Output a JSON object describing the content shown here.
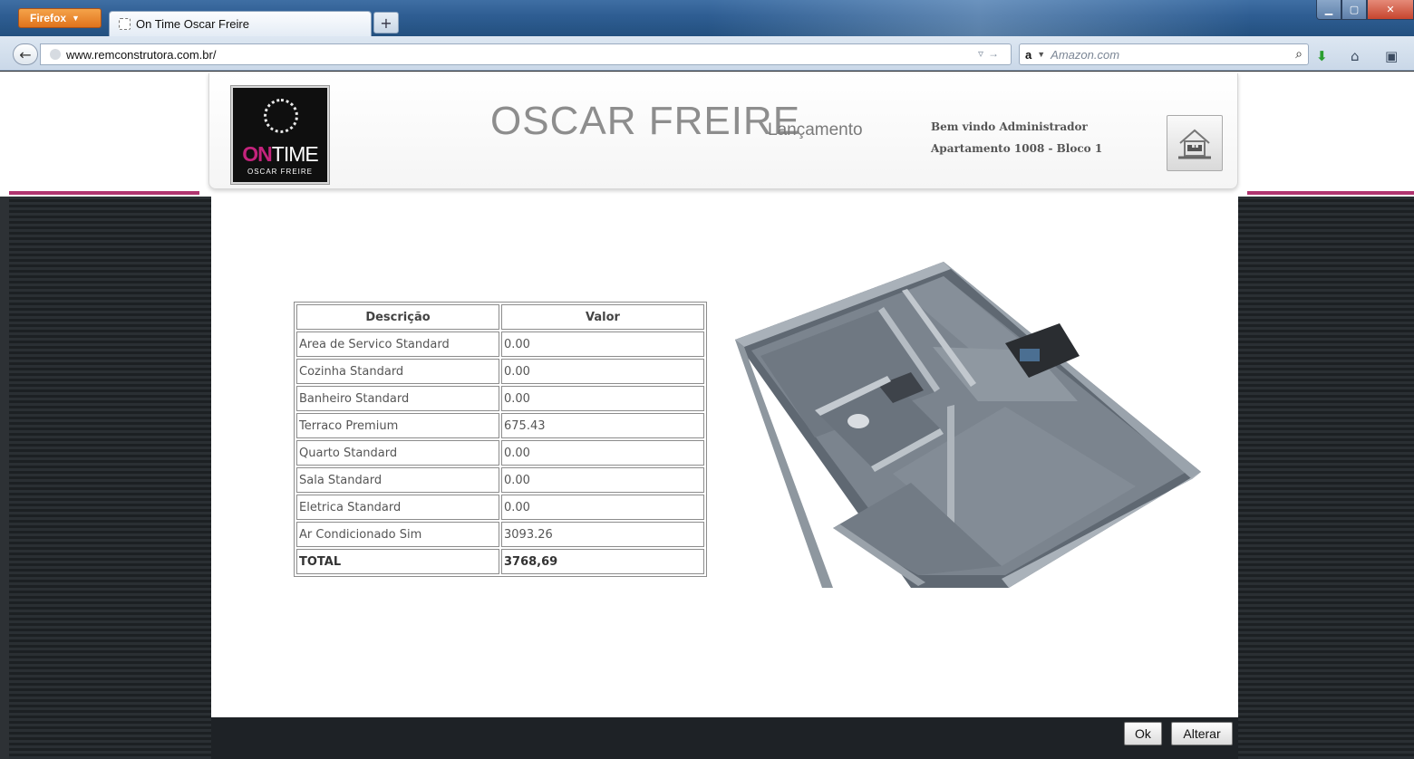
{
  "browser": {
    "menu_button": "Firefox",
    "tab_title": "On Time Oscar Freire",
    "new_tab": "+",
    "url": "www.remconstrutora.com.br/",
    "search_engine": "a",
    "search_placeholder": "Amazon.com",
    "icons": [
      "back-icon",
      "search-icon",
      "download-icon",
      "home-icon",
      "bookmarks-icon"
    ]
  },
  "header": {
    "logo": {
      "on": "ON",
      "time": "TIME",
      "sub": "OSCAR FREIRE"
    },
    "title": "OSCAR FREIRE",
    "subtitle": "Lançamento",
    "welcome": "Bem vindo Administrador",
    "apartment": "Apartamento 1008 - Bloco 1"
  },
  "table": {
    "headers": [
      "Descrição",
      "Valor"
    ],
    "rows": [
      {
        "desc": "Area de Servico Standard",
        "value": "0.00"
      },
      {
        "desc": "Cozinha Standard",
        "value": "0.00"
      },
      {
        "desc": "Banheiro Standard",
        "value": "0.00"
      },
      {
        "desc": "Terraco Premium",
        "value": "675.43"
      },
      {
        "desc": "Quarto Standard",
        "value": "0.00"
      },
      {
        "desc": "Sala Standard",
        "value": "0.00"
      },
      {
        "desc": "Eletrica Standard",
        "value": "0.00"
      },
      {
        "desc": "Ar Condicionado Sim",
        "value": "3093.26"
      }
    ],
    "total": {
      "desc": "TOTAL",
      "value": "3768,69"
    }
  },
  "buttons": {
    "ok": "Ok",
    "alterar": "Alterar"
  },
  "colors": {
    "accent": "#b0346f",
    "brand": "#c4237c"
  }
}
